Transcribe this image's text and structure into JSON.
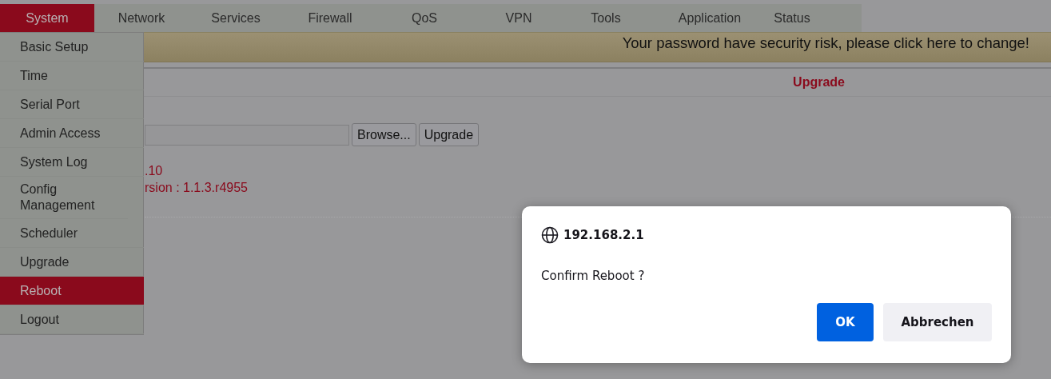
{
  "nav": [
    {
      "label": "System",
      "selected": true
    },
    {
      "label": "Network",
      "selected": false
    },
    {
      "label": "Services",
      "selected": false
    },
    {
      "label": "Firewall",
      "selected": false
    },
    {
      "label": "QoS",
      "selected": false
    },
    {
      "label": "VPN",
      "selected": false
    },
    {
      "label": "Tools",
      "selected": false
    },
    {
      "label": "Application",
      "selected": false
    },
    {
      "label": "Status",
      "selected": false
    }
  ],
  "banner": "Your password have security risk, please click here to change!",
  "section_title": "Upgrade",
  "upload": {
    "browse_button": "Browse...",
    "upgrade_button": "Upgrade"
  },
  "info_lines": [
    ".10",
    "rsion : 1.1.3.r4955"
  ],
  "menu": [
    {
      "label": "Basic Setup",
      "selected": false
    },
    {
      "label": "Time",
      "selected": false
    },
    {
      "label": "Serial Port",
      "selected": false
    },
    {
      "label": "Admin Access",
      "selected": false
    },
    {
      "label": "System Log",
      "selected": false
    },
    {
      "label": "Config Management",
      "selected": false
    },
    {
      "label": "Scheduler",
      "selected": false
    },
    {
      "label": "Upgrade",
      "selected": false
    },
    {
      "label": "Reboot",
      "selected": true
    },
    {
      "label": "Logout",
      "selected": false
    }
  ],
  "dialog": {
    "origin": "192.168.2.1",
    "message": "Confirm Reboot ?",
    "ok_button": "OK",
    "cancel_button": "Abbrechen"
  }
}
